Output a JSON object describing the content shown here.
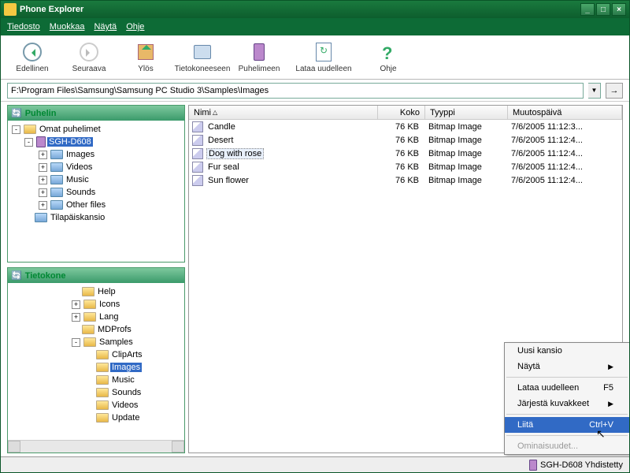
{
  "title": "Phone Explorer",
  "menu": {
    "file": "Tiedosto",
    "edit": "Muokkaa",
    "view": "Näytä",
    "help": "Ohje"
  },
  "toolbar": {
    "back": "Edellinen",
    "forward": "Seuraava",
    "up": "Ylös",
    "toComputer": "Tietokoneeseen",
    "toPhone": "Puhelimeen",
    "reload": "Lataa uudelleen",
    "help": "Ohje"
  },
  "address": "F:\\Program Files\\Samsung\\Samsung PC Studio 3\\Samples\\Images",
  "panels": {
    "phone": "Puhelin",
    "computer": "Tietokone"
  },
  "phoneTree": {
    "root": "Omat puhelimet",
    "device": "SGH-D608",
    "items": [
      "Images",
      "Videos",
      "Music",
      "Sounds",
      "Other files"
    ],
    "temp": "Tilapäiskansio"
  },
  "pcTree": {
    "items": [
      "Help",
      "Icons",
      "Lang",
      "MDProfs",
      "Samples"
    ],
    "samplesChildren": [
      "ClipArts",
      "Images",
      "Music",
      "Sounds",
      "Videos",
      "Update"
    ]
  },
  "columns": {
    "name": "Nimi",
    "size": "Koko",
    "type": "Tyyppi",
    "modified": "Muutospäivä"
  },
  "files": [
    {
      "name": "Candle",
      "size": "76 KB",
      "type": "Bitmap Image",
      "date": "7/6/2005 11:12:3..."
    },
    {
      "name": "Desert",
      "size": "76 KB",
      "type": "Bitmap Image",
      "date": "7/6/2005 11:12:4..."
    },
    {
      "name": "Dog with rose",
      "size": "76 KB",
      "type": "Bitmap Image",
      "date": "7/6/2005 11:12:4..."
    },
    {
      "name": "Fur seal",
      "size": "76 KB",
      "type": "Bitmap Image",
      "date": "7/6/2005 11:12:4..."
    },
    {
      "name": "Sun flower",
      "size": "76 KB",
      "type": "Bitmap Image",
      "date": "7/6/2005 11:12:4..."
    }
  ],
  "context": {
    "newFolder": "Uusi kansio",
    "view": "Näytä",
    "reload": "Lataa uudelleen",
    "reloadKey": "F5",
    "arrange": "Järjestä kuvakkeet",
    "paste": "Liitä",
    "pasteKey": "Ctrl+V",
    "properties": "Ominaisuudet..."
  },
  "status": "SGH-D608 Yhdistetty"
}
